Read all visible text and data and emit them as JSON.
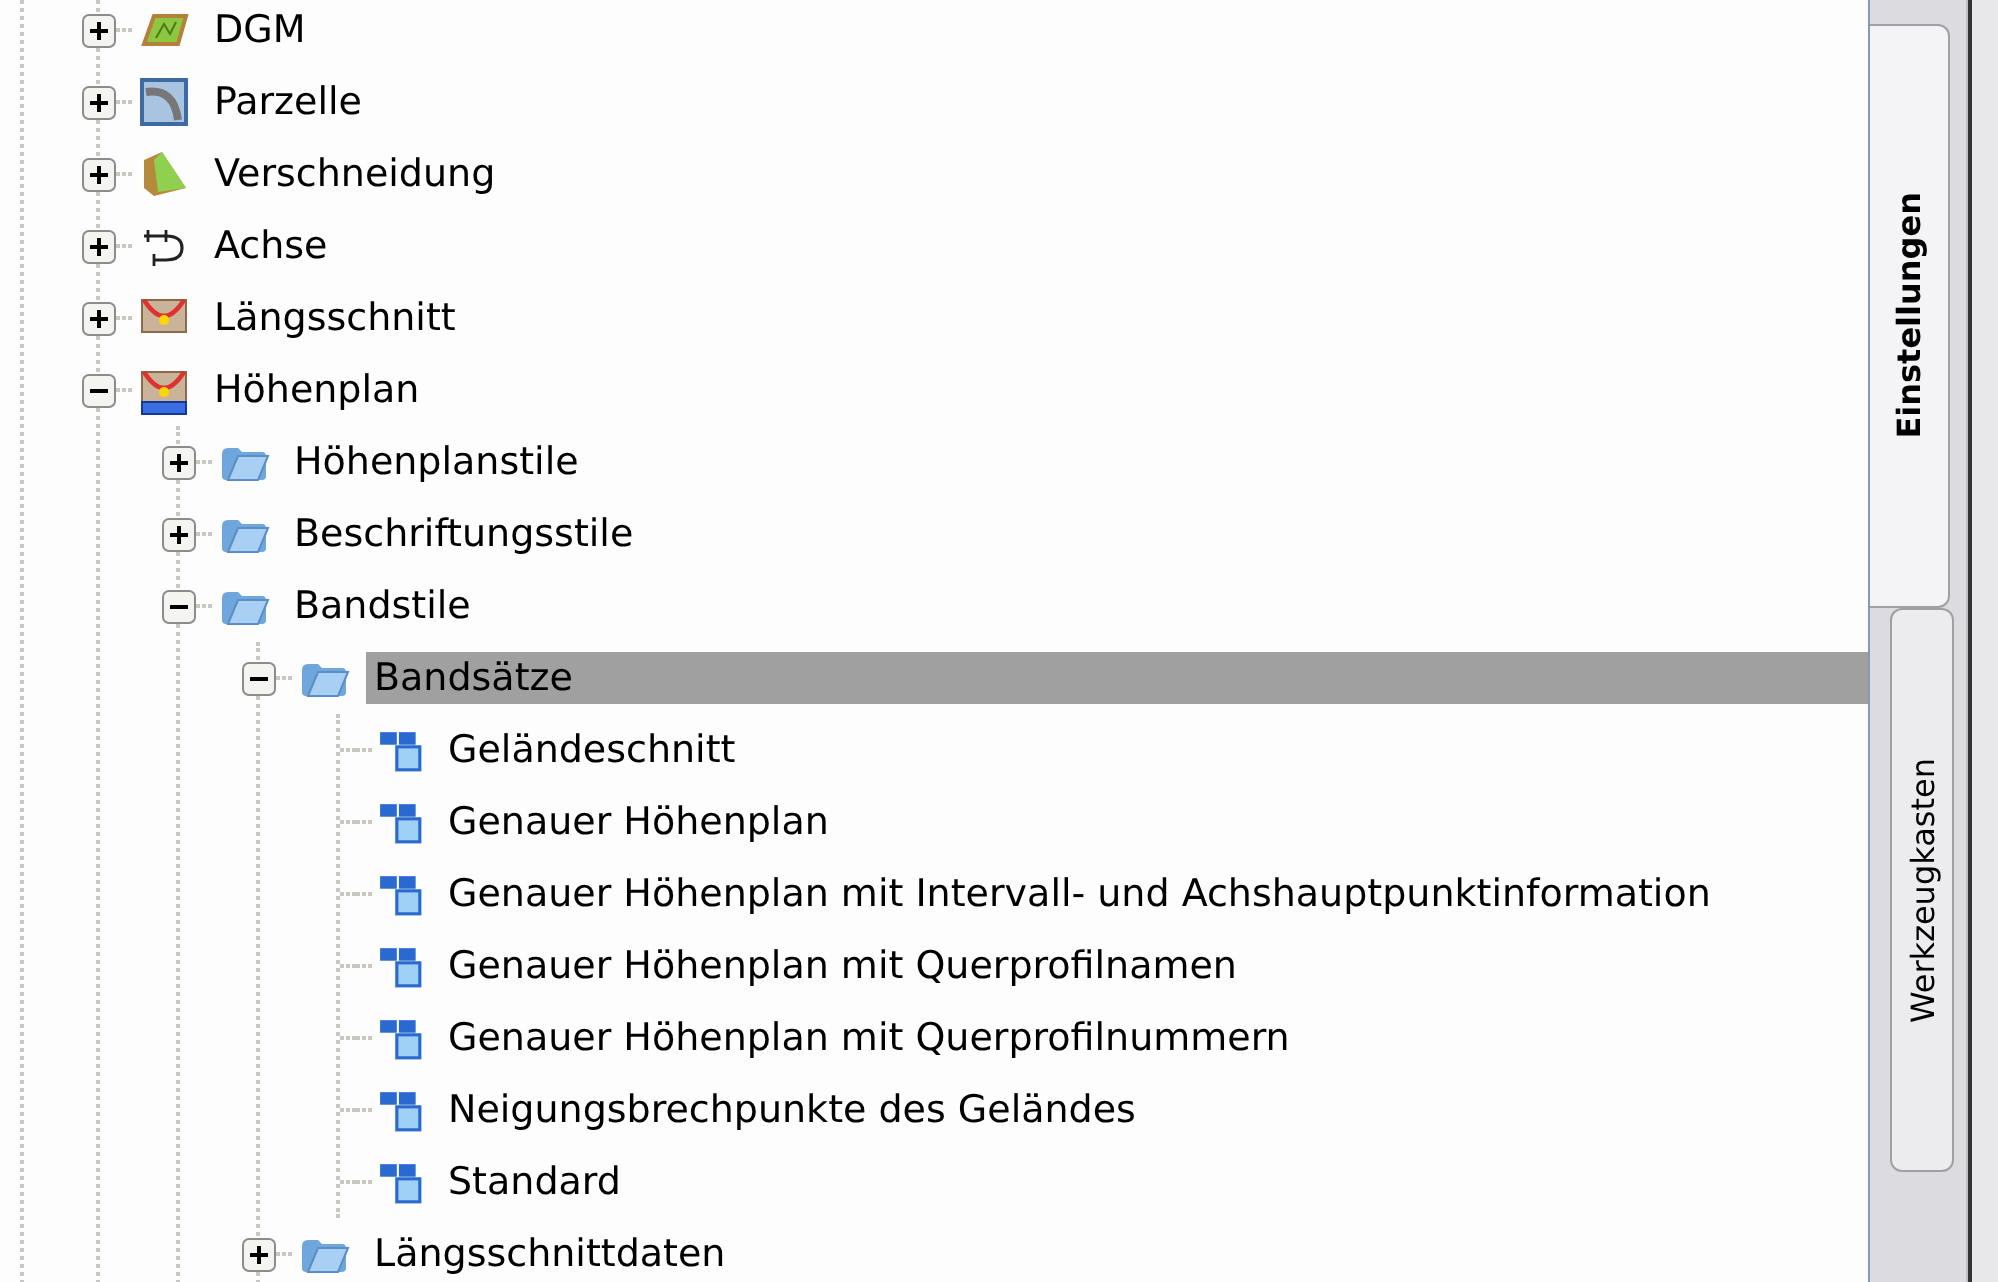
{
  "tree": [
    {
      "label": "DGM",
      "kind": "surface",
      "expanded": false,
      "selected": false
    },
    {
      "label": "Parzelle",
      "kind": "parcel",
      "expanded": false,
      "selected": false
    },
    {
      "label": "Verschneidung",
      "kind": "grading",
      "expanded": false,
      "selected": false
    },
    {
      "label": "Achse",
      "kind": "alignment",
      "expanded": false,
      "selected": false
    },
    {
      "label": "Längsschnitt",
      "kind": "profile",
      "expanded": false,
      "selected": false
    },
    {
      "label": "Höhenplan",
      "kind": "profile-view",
      "expanded": true,
      "selected": false,
      "children": [
        {
          "label": "Höhenplanstile",
          "kind": "folder",
          "expanded": false,
          "selected": false
        },
        {
          "label": "Beschriftungsstile",
          "kind": "folder",
          "expanded": false,
          "selected": false
        },
        {
          "label": "Bandstile",
          "kind": "folder",
          "expanded": true,
          "selected": false,
          "children": [
            {
              "label": "Bandsätze",
              "kind": "folder",
              "expanded": true,
              "selected": true,
              "children": [
                {
                  "label": "Geländeschnitt",
                  "kind": "style",
                  "selected": false
                },
                {
                  "label": "Genauer Höhenplan",
                  "kind": "style",
                  "selected": false
                },
                {
                  "label": "Genauer Höhenplan mit Intervall- und Achshauptpunktinformation",
                  "kind": "style",
                  "selected": false
                },
                {
                  "label": "Genauer Höhenplan mit Querprofilnamen",
                  "kind": "style",
                  "selected": false
                },
                {
                  "label": "Genauer Höhenplan mit Querprofilnummern",
                  "kind": "style",
                  "selected": false
                },
                {
                  "label": "Neigungsbrechpunkte des Geländes",
                  "kind": "style",
                  "selected": false
                },
                {
                  "label": "Standard",
                  "kind": "style",
                  "selected": false
                }
              ]
            },
            {
              "label": "Längsschnittdaten",
              "kind": "folder",
              "expanded": false,
              "selected": false
            }
          ]
        }
      ]
    }
  ],
  "side_tabs": [
    {
      "label": "Einstellungen",
      "selected": true
    },
    {
      "label": "Werkzeugkasten",
      "selected": false
    }
  ]
}
